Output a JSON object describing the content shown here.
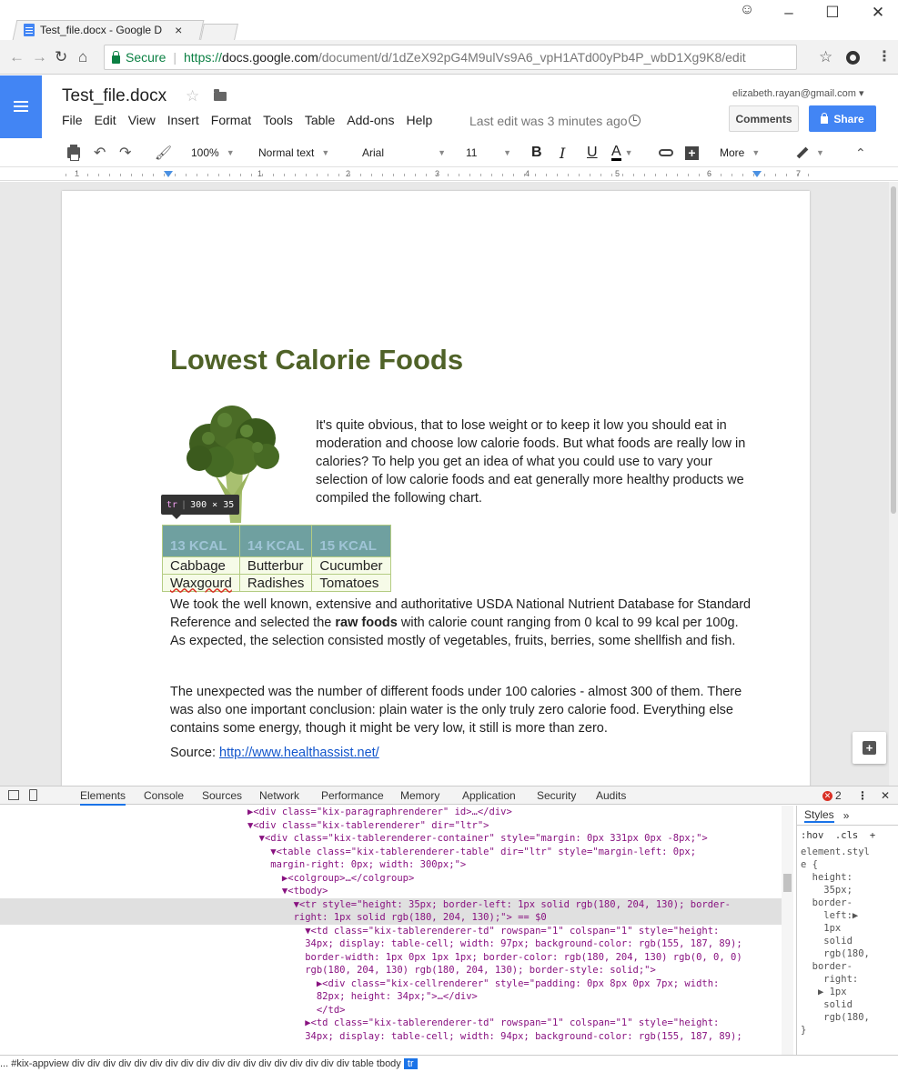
{
  "browser": {
    "tab_title": "Test_file.docx - Google D",
    "tab_close": "×",
    "win_minimize": "–",
    "win_maximize": "☐",
    "win_close": "✕",
    "secure_label": "Secure",
    "url_scheme": "https://",
    "url_host": "docs.google.com",
    "url_path": "/document/d/1dZeX92pG4M9ulVs9A6_vpH1ATd00yPb4P_wbD1Xg9K8/edit"
  },
  "docs": {
    "title": "Test_file.docx",
    "menu": [
      "File",
      "Edit",
      "View",
      "Insert",
      "Format",
      "Tools",
      "Table",
      "Add-ons",
      "Help"
    ],
    "last_edit": "Last edit was 3 minutes ago",
    "account": "elizabeth.rayan@gmail.com",
    "comments_label": "Comments",
    "share_label": "Share",
    "toolbar": {
      "zoom": "100%",
      "style": "Normal text",
      "font": "Arial",
      "size": "11",
      "bold": "B",
      "italic": "I",
      "underline": "U",
      "text_color": "A",
      "more": "More"
    },
    "ruler_numbers": [
      "1",
      "1",
      "2",
      "3",
      "4",
      "5",
      "6",
      "7"
    ]
  },
  "document": {
    "heading": "Lowest Calorie Foods",
    "intro": "It's quite obvious, that to lose weight or to keep it low you should eat in moderation and choose low calorie foods. But what foods are really low in calories? To help you get an idea of what you could use to vary your selection of low calorie foods and eat generally more healthy products we compiled the following chart.",
    "tooltip_tag": "tr",
    "tooltip_size": "300 × 35",
    "table": {
      "headers": [
        "13 KCAL",
        "14 KCAL",
        "15 KCAL"
      ],
      "rows": [
        [
          "Cabbage",
          "Butterbur",
          "Cucumber"
        ],
        [
          "Waxgourd",
          "Radishes",
          "Tomatoes"
        ]
      ]
    },
    "para1_a": "We took the well known, extensive and authoritative USDA National Nutrient Database for Standard Reference and selected the ",
    "para1_bold": "raw foods",
    "para1_b": " with calorie count ranging from 0 kcal to 99 kcal per 100g. As expected, the selection consisted mostly of vegetables, fruits, berries, some shellfish and fish.",
    "para2": "The unexpected was the number of different foods under 100 calories - almost 300 of them. There was also one important conclusion: plain water is the only truly zero calorie food. Everything else contains some energy, though it might be very low, it still is more than zero.",
    "source_label": "Source: ",
    "source_link": "http://www.healthassist.net/"
  },
  "devtools": {
    "tabs": [
      "Elements",
      "Console",
      "Sources",
      "Network",
      "Performance",
      "Memory",
      "Application",
      "Security",
      "Audits"
    ],
    "error_count": "2",
    "styles_tab": "Styles",
    "styles_more": "»",
    "styles_filter": ":hov  .cls  +",
    "styles_lines": [
      "element.styl",
      "e {",
      "  height:",
      "    35px;",
      "  border-",
      "    left:▶",
      "    1px",
      "    solid",
      "    rgb(180,",
      "  border-",
      "    right:",
      "   ▶ 1px",
      "    solid",
      "    rgb(180,",
      "}"
    ],
    "code_lines": [
      "▶<div class=\"kix-paragraphrenderer\" id>…</div>",
      "▼<div class=\"kix-tablerenderer\" dir=\"ltr\">",
      "  ▼<div class=\"kix-tablerenderer-container\" style=\"margin: 0px 331px 0px -8px;\">",
      "    ▼<table class=\"kix-tablerenderer-table\" dir=\"ltr\" style=\"margin-left: 0px;",
      "    margin-right: 0px; width: 300px;\">",
      "      ▶<colgroup>…</colgroup>",
      "      ▼<tbody>",
      "        ▼<tr style=\"height: 35px; border-left: 1px solid rgb(180, 204, 130); border-",
      "        right: 1px solid rgb(180, 204, 130);\"> == $0",
      "          ▼<td class=\"kix-tablerenderer-td\" rowspan=\"1\" colspan=\"1\" style=\"height:",
      "          34px; display: table-cell; width: 97px; background-color: rgb(155, 187, 89);",
      "          border-width: 1px 0px 1px 1px; border-color: rgb(180, 204, 130) rgb(0, 0, 0)",
      "          rgb(180, 204, 130) rgb(180, 204, 130); border-style: solid;\">",
      "            ▶<div class=\"kix-cellrenderer\" style=\"padding: 0px 8px 0px 7px; width:",
      "            82px; height: 34px;\">…</div>",
      "            </td>",
      "          ▶<td class=\"kix-tablerenderer-td\" rowspan=\"1\" colspan=\"1\" style=\"height:",
      "          34px; display: table-cell; width: 94px; background-color: rgb(155, 187, 89);"
    ],
    "breadcrumbs": "...  #kix-appview  div  div  div  div  div  div  div  div  div  div  div  div  div  div  div  div  div  div  table  tbody",
    "breadcrumb_active": "tr"
  },
  "colors": {
    "heading": "#4f6228",
    "docs_blue": "#4285f4",
    "table_border": "#b4cc82"
  }
}
